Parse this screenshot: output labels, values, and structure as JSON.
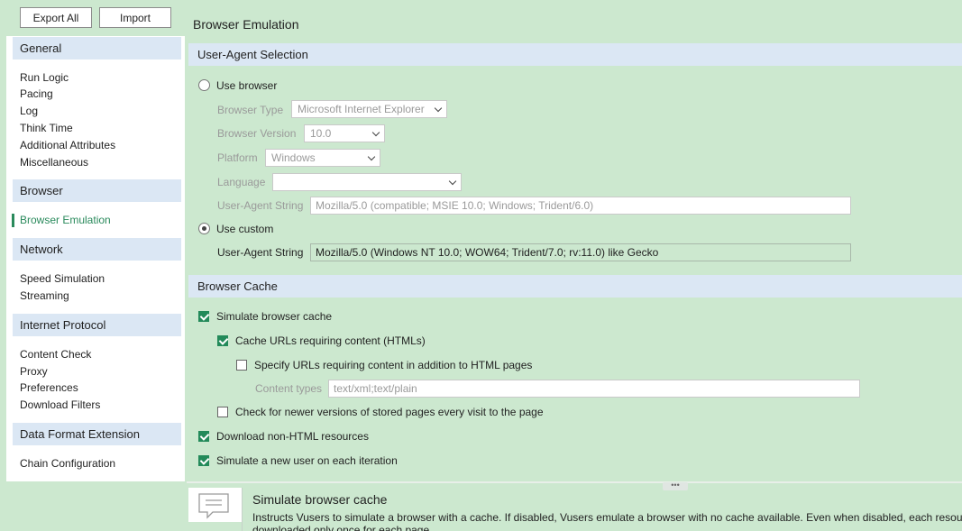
{
  "toolbar": {
    "export_all": "Export All",
    "import": "Import"
  },
  "nav": {
    "general": {
      "header": "General",
      "items": [
        "Run Logic",
        "Pacing",
        "Log",
        "Think Time",
        "Additional Attributes",
        "Miscellaneous"
      ]
    },
    "browser": {
      "header": "Browser",
      "items": [
        "Browser Emulation"
      ]
    },
    "network": {
      "header": "Network",
      "items": [
        "Speed Simulation",
        "Streaming"
      ]
    },
    "internet_protocol": {
      "header": "Internet Protocol",
      "items": [
        "Content Check",
        "Proxy",
        "Preferences",
        "Download Filters"
      ]
    },
    "data_format": {
      "header": "Data Format Extension",
      "items": [
        "Chain Configuration"
      ]
    },
    "active_item": "Browser Emulation"
  },
  "page": {
    "title": "Browser Emulation",
    "ua_section": {
      "header": "User-Agent Selection",
      "use_browser_label": "Use browser",
      "use_browser_selected": false,
      "browser_type_label": "Browser Type",
      "browser_type_value": "Microsoft Internet Explorer",
      "browser_version_label": "Browser Version",
      "browser_version_value": "10.0",
      "platform_label": "Platform",
      "platform_value": "Windows",
      "language_label": "Language",
      "language_value": "",
      "ua_string_label": "User-Agent String",
      "ua_string_browser_value": "Mozilla/5.0 (compatible; MSIE 10.0; Windows; Trident/6.0)",
      "use_custom_label": "Use custom",
      "use_custom_selected": true,
      "custom_ua_string_label": "User-Agent String",
      "custom_ua_string_value": "Mozilla/5.0 (Windows NT 10.0; WOW64; Trident/7.0; rv:11.0) like Gecko"
    },
    "cache_section": {
      "header": "Browser Cache",
      "simulate_cache_label": "Simulate browser cache",
      "simulate_cache_checked": true,
      "cache_urls_label": "Cache URLs requiring content (HTMLs)",
      "cache_urls_checked": true,
      "specify_urls_label": "Specify URLs requiring content in addition to HTML pages",
      "specify_urls_checked": false,
      "content_types_label": "Content types",
      "content_types_value": "text/xml;text/plain",
      "check_newer_label": "Check for newer versions of stored pages every visit to the page",
      "check_newer_checked": false,
      "download_non_html_label": "Download non-HTML resources",
      "download_non_html_checked": true,
      "new_user_label": "Simulate a new user on each iteration",
      "new_user_checked": true
    }
  },
  "info": {
    "icon": "comment-icon",
    "title": "Simulate browser cache",
    "description": "Instructs Vusers to simulate a browser with a cache. If disabled, Vusers emulate a browser with no cache available. Even when disabled, each resou",
    "description_line2": "downloaded only once for each page."
  },
  "colors": {
    "background": "#cce8cf",
    "section_header": "#dbe7f4",
    "accent": "#2a8a5c"
  }
}
